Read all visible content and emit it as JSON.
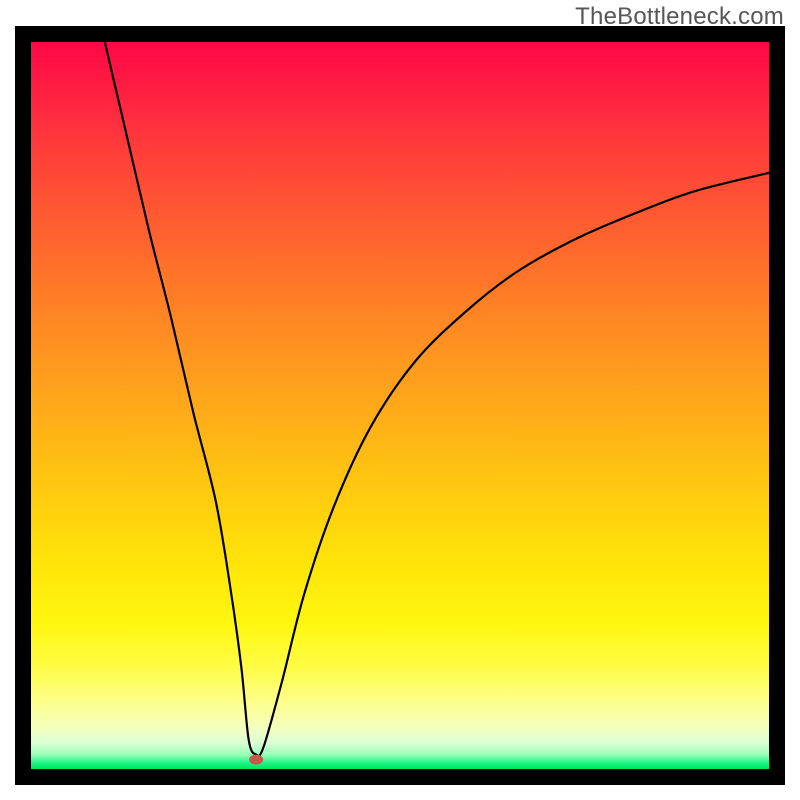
{
  "watermark": {
    "text": "TheBottleneck.com"
  },
  "colors": {
    "border": "#000000",
    "curve": "#000000",
    "marker": "#c65a48",
    "watermark_text": "#565656",
    "gradient_top": "#ff0745",
    "gradient_bottom": "#00e558"
  },
  "chart_data": {
    "type": "line",
    "title": "",
    "xlabel": "",
    "ylabel": "",
    "xlim": [
      0,
      100
    ],
    "ylim": [
      0,
      100
    ],
    "grid": false,
    "legend": false,
    "series": [
      {
        "name": "curve",
        "x": [
          10,
          13,
          16,
          19,
          22,
          25,
          27,
          28.5,
          29.5,
          30.5,
          31.5,
          34,
          37,
          41,
          46,
          52,
          59,
          66,
          74,
          82,
          90,
          100
        ],
        "values": [
          100,
          87,
          74,
          62,
          49,
          37,
          25,
          14,
          4,
          2,
          3,
          12,
          24,
          36,
          47,
          56,
          63,
          68.5,
          73,
          76.5,
          79.5,
          82
        ]
      }
    ],
    "annotations": [
      {
        "type": "marker",
        "x": 30.5,
        "y": 1.3,
        "shape": "ellipse",
        "label": ""
      }
    ]
  },
  "marker": {
    "cx_pct": 30.5,
    "cy_pct_from_top": 98.7,
    "rx": 7,
    "ry": 5
  }
}
